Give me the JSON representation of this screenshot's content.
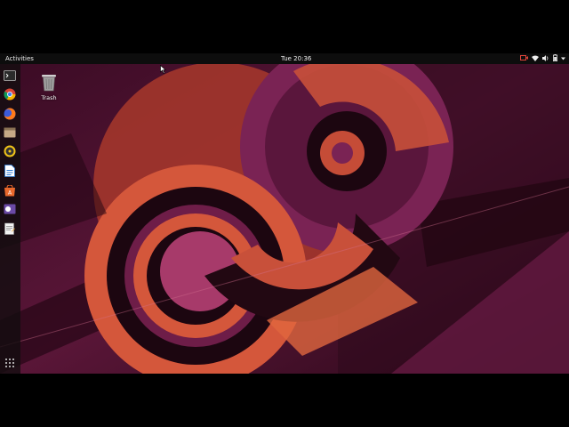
{
  "topbar": {
    "activities_label": "Activities",
    "clock": "Tue 20:36",
    "tray_icons": [
      "screen-recording-icon",
      "wifi-icon",
      "volume-icon",
      "battery-icon",
      "system-menu-arrow-icon"
    ]
  },
  "dock": {
    "items": [
      {
        "name": "Terminal",
        "icon": "terminal-icon"
      },
      {
        "name": "Chromium",
        "icon": "chromium-icon"
      },
      {
        "name": "Firefox",
        "icon": "firefox-icon"
      },
      {
        "name": "Files",
        "icon": "files-icon"
      },
      {
        "name": "Rhythmbox",
        "icon": "rhythmbox-icon"
      },
      {
        "name": "LibreOffice Writer",
        "icon": "writer-icon"
      },
      {
        "name": "Ubuntu Software",
        "icon": "software-icon"
      },
      {
        "name": "Help",
        "icon": "help-icon"
      },
      {
        "name": "Text Editor",
        "icon": "text-editor-icon"
      }
    ],
    "show_apps_icon": "show-applications-icon"
  },
  "desktop": {
    "trash_label": "Trash"
  },
  "colors": {
    "wallpaper_base": "#4a1231",
    "wallpaper_orange": "#d4573b",
    "wallpaper_magenta": "#8c2a5e",
    "panel": "#0d0d0d"
  }
}
